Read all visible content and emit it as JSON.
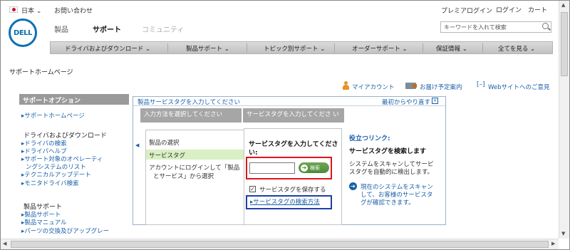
{
  "topbar": {
    "country": "日本",
    "contact": "お問い合わせ",
    "premier_login": "プレミアログイン",
    "login": "ログイン",
    "cart": "カート"
  },
  "brand": {
    "logo_text": "DELL"
  },
  "main_tabs": [
    "製品",
    "サポート",
    "コミュニティ"
  ],
  "search": {
    "placeholder": "キーワードを入れて検索"
  },
  "nav": [
    "ドライバおよびダウンロード ⌄",
    "製品サポート ⌄",
    "トピック別サポート ⌄",
    "オーダーサポート ⌄",
    "保証情報 ⌄",
    "全てを見る ⌄"
  ],
  "breadcrumb": "サポートホームページ",
  "util_links": {
    "my_account": "マイアカウント",
    "delivery": "お届け予定案内",
    "feedback": "Webサイトへのご意見"
  },
  "sidebar": {
    "heading": "サポートオプション",
    "home_link": "サポートホームページ",
    "sections": [
      {
        "title": "ドライバおよびダウンロード",
        "links": [
          "ドライバの検索",
          "ドライバヘルプ",
          "サポート対象のオペレーティ",
          "ングシステムのリスト",
          "テクニカルアップデート",
          "モニタドライバ検索"
        ]
      },
      {
        "title": "製品サポート",
        "links": [
          "製品サポート",
          "製品マニュアル",
          "パーツの交換及びアップグレー"
        ]
      }
    ]
  },
  "panel": {
    "title": "製品サービスタグを入力してください",
    "restart": "最初からやり直す",
    "left_header": "入力方法を選択してください",
    "mid_header": "サービスタグを入力してくださ い",
    "options": [
      "製品の選択",
      "サービスタグ",
      "アカウントにログインして「製品",
      "とサービス」から選択"
    ],
    "mid_prompt_line1": "サービスタグを入力してくださ",
    "mid_prompt_line2": "い:",
    "go_button": "検索",
    "save_tag": "サービスタグを保存する",
    "howto_link": "サービスタグの検索方法",
    "quick_links_title": "役立つリンク:",
    "find_tag_title": "サービスタグを検索します",
    "find_tag_desc1": "システムをスキャンしてサービ",
    "find_tag_desc2": "スタグを自動的に検出します。",
    "scan_link1": "現在のシステムをスキャン",
    "scan_link2": "して、お客様のサービスタ",
    "scan_link3": "グが確認できます。"
  }
}
